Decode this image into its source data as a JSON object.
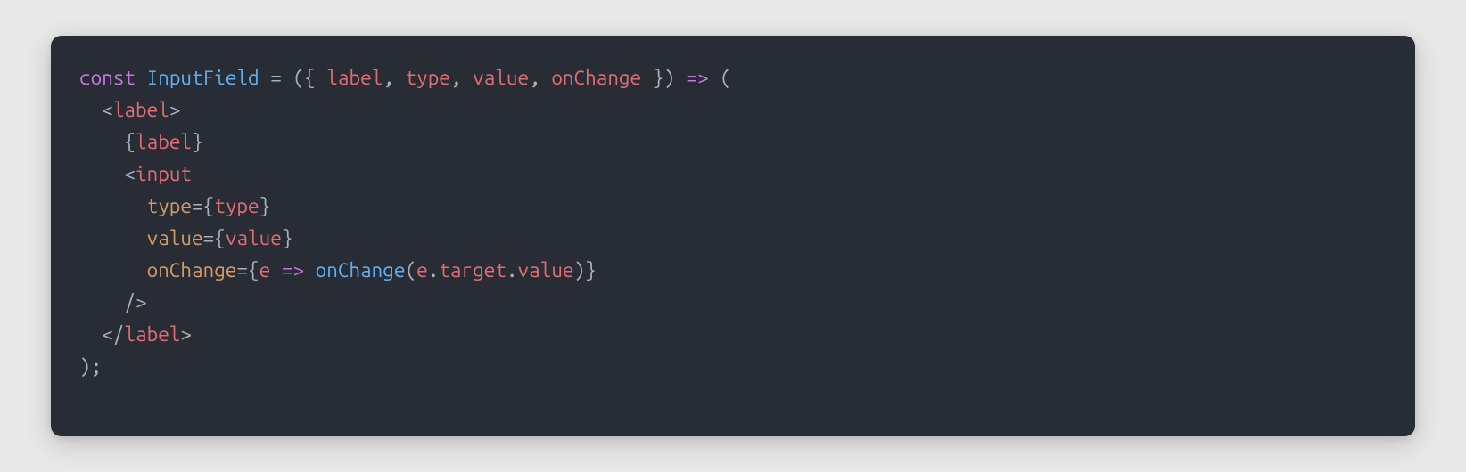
{
  "code": {
    "line1": {
      "const": "const",
      "space1": " ",
      "name": "InputField",
      "space2": " ",
      "eq": "=",
      "space3": " ",
      "open": "({ ",
      "p1": "label",
      "c1": ", ",
      "p2": "type",
      "c2": ", ",
      "p3": "value",
      "c3": ", ",
      "p4": "onChange",
      "close": " }) ",
      "arrow": "=>",
      "tail": " ("
    },
    "line2": {
      "indent": "  ",
      "lt": "<",
      "tag": "label",
      "gt": ">"
    },
    "line3": {
      "indent": "    ",
      "lb": "{",
      "expr": "label",
      "rb": "}"
    },
    "line4": {
      "indent": "    ",
      "lt": "<",
      "tag": "input"
    },
    "line5": {
      "indent": "      ",
      "attr": "type",
      "eq": "=",
      "lb": "{",
      "expr": "type",
      "rb": "}"
    },
    "line6": {
      "indent": "      ",
      "attr": "value",
      "eq": "=",
      "lb": "{",
      "expr": "value",
      "rb": "}"
    },
    "line7": {
      "indent": "      ",
      "attr": "onChange",
      "eq": "=",
      "lb": "{",
      "arg": "e",
      "space1": " ",
      "arrow": "=>",
      "space2": " ",
      "fn": "onChange",
      "open": "(",
      "obj": "e",
      "dot1": ".",
      "m1": "target",
      "dot2": ".",
      "m2": "value",
      "close": ")",
      "rb": "}"
    },
    "line8": {
      "indent": "    ",
      "text": "/>"
    },
    "line9": {
      "indent": "  ",
      "lt": "</",
      "tag": "label",
      "gt": ">"
    },
    "line10": {
      "text": ");"
    }
  }
}
